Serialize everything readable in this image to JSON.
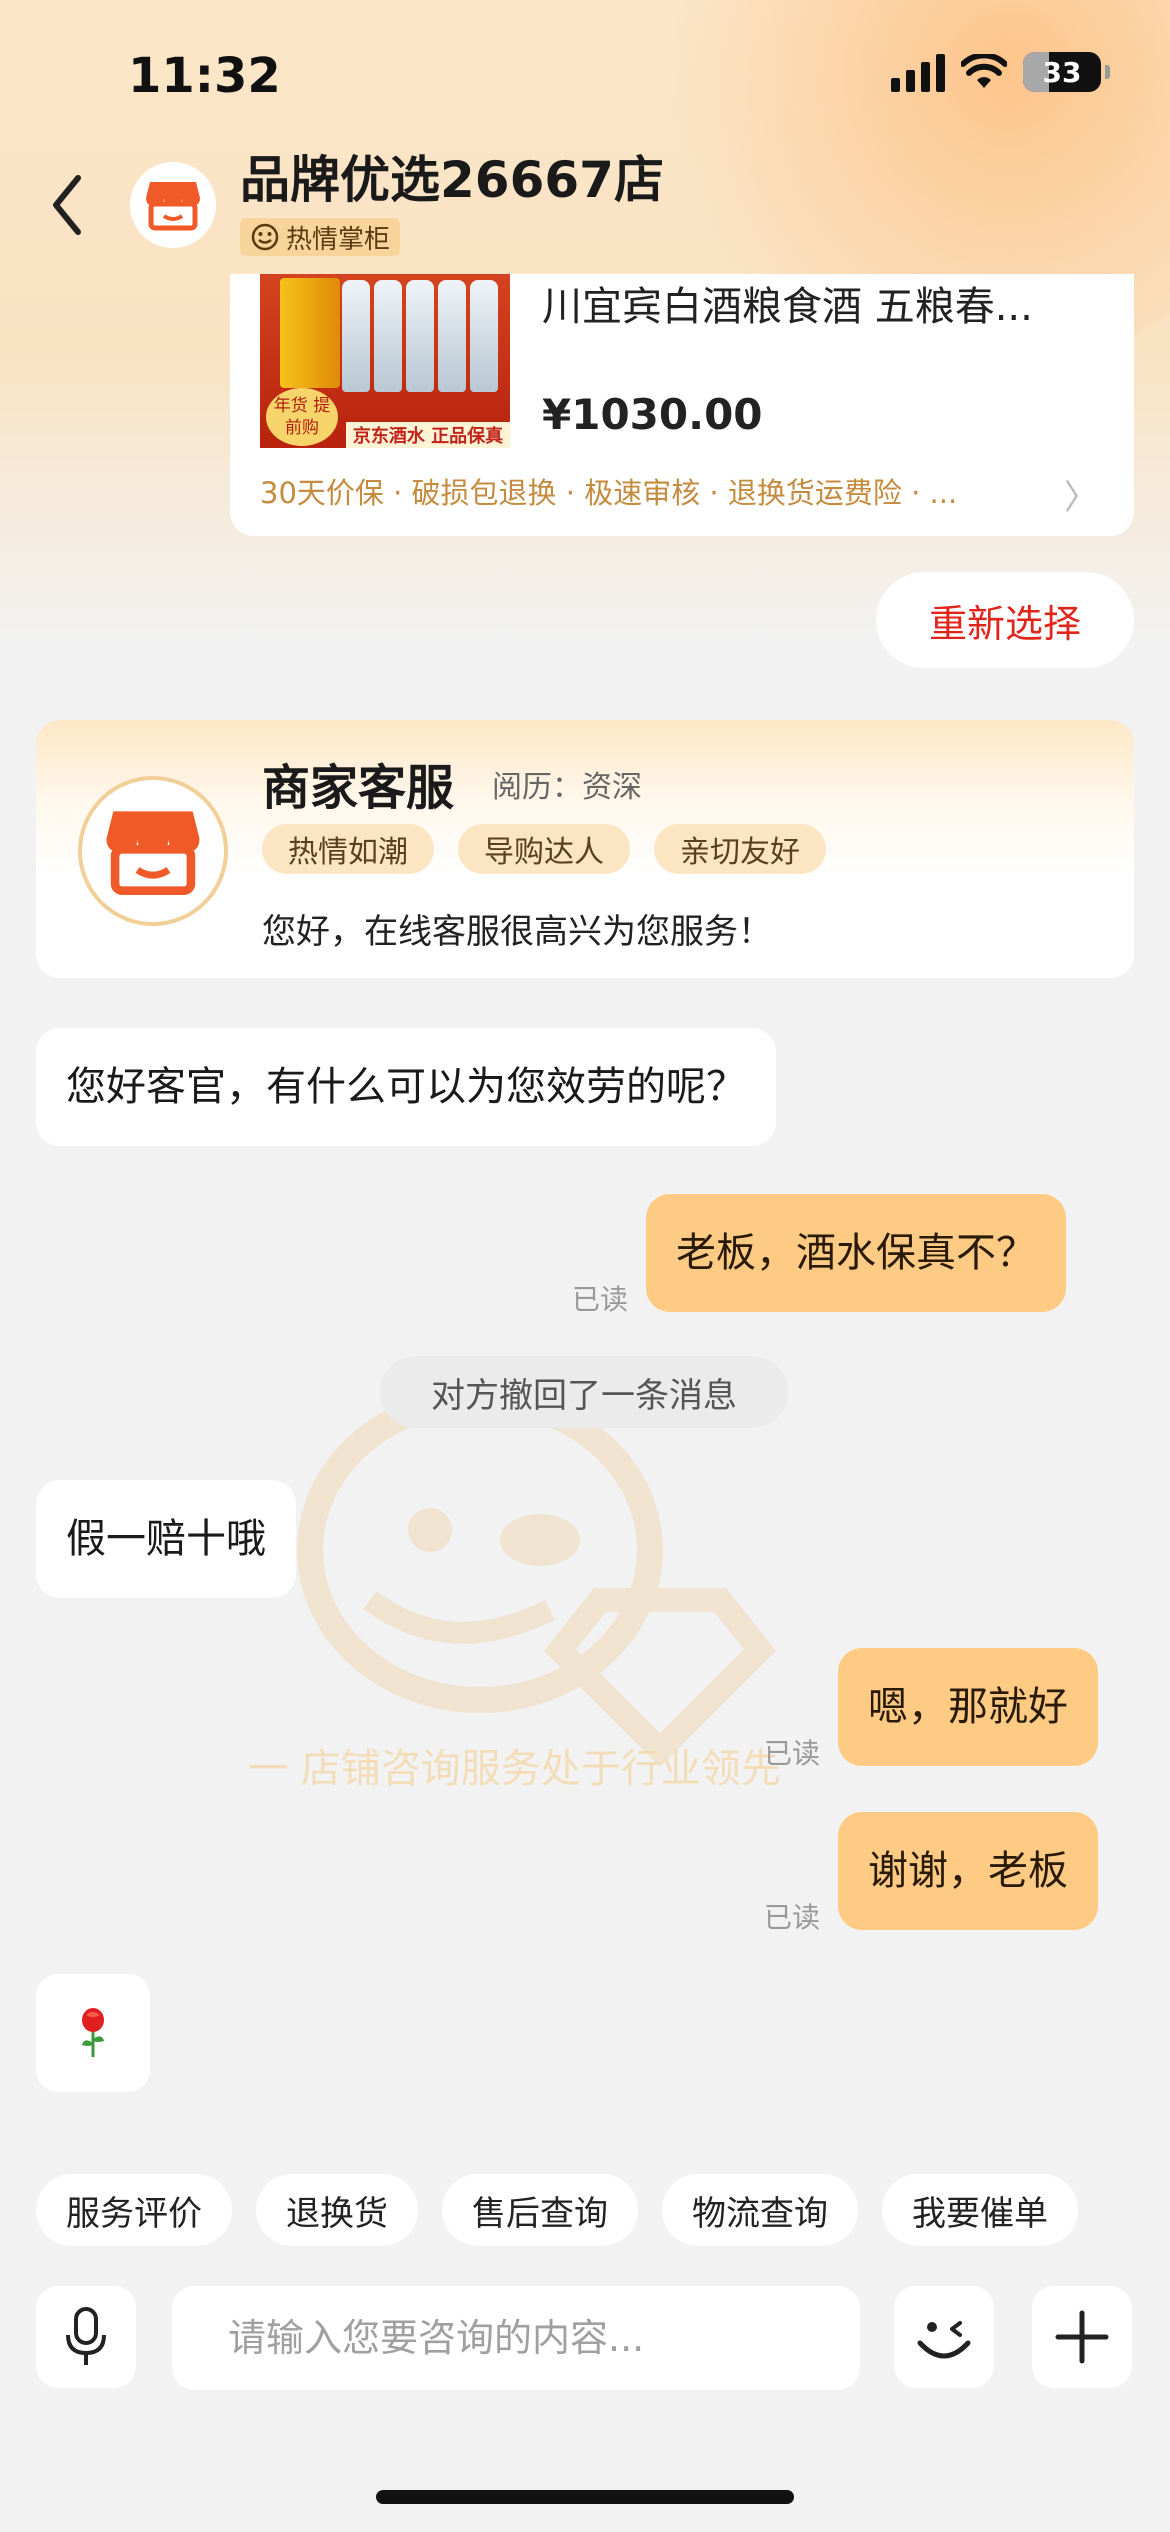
{
  "status_bar": {
    "time": "11:32",
    "battery": "33"
  },
  "header": {
    "shop_name": "品牌优选26667店",
    "badge": "热情掌柜"
  },
  "product": {
    "name": "川宜宾白酒粮食酒 五粮春...",
    "price": "¥1030.00",
    "image_strip": "京东酒水 正品保真",
    "image_tag": "年货 提前购",
    "services": "30天价保 · 破损包退换 · 极速审核 · 退换货运费险 · ..."
  },
  "reselect_label": "重新选择",
  "merchant": {
    "name": "商家客服",
    "experience": "阅历：资深",
    "tags": [
      "热情如潮",
      "导购达人",
      "亲切友好"
    ],
    "greeting": "您好，在线客服很高兴为您服务！"
  },
  "messages": {
    "m1": "您好客官，有什么可以为您效劳的呢？",
    "m2": "老板，酒水保真不？",
    "recall": "对方撤回了一条消息",
    "m3": "假一赔十哦",
    "m4": "嗯，那就好",
    "m5": "谢谢，老板",
    "read": "已读"
  },
  "watermark_text": "一  店铺咨询服务处于行业领先",
  "quick_actions": [
    "服务评价",
    "退换货",
    "售后查询",
    "物流查询",
    "我要催单"
  ],
  "input": {
    "placeholder": "请输入您要咨询的内容..."
  },
  "colors": {
    "accent": "#e1251b",
    "bubble_self": "#fdcb84",
    "background": "#f2f2f2"
  }
}
